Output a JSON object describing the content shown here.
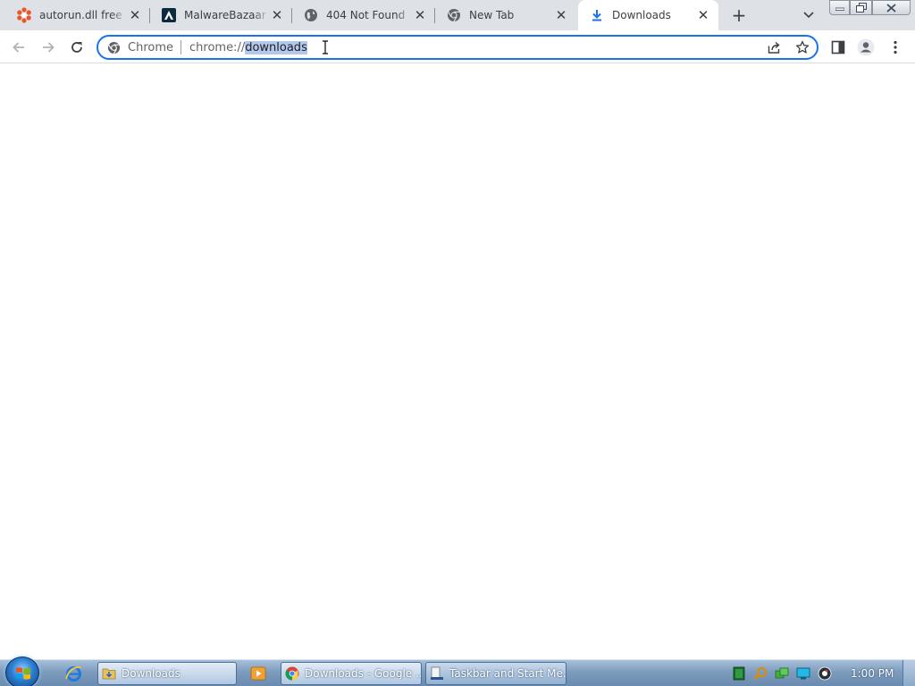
{
  "browser": {
    "tabs": [
      {
        "title": "autorun.dll free download",
        "icon": "autorun-site-icon",
        "active": false
      },
      {
        "title": "MalwareBazaar | Database",
        "icon": "malwarebazaar-icon",
        "active": false
      },
      {
        "title": "404 Not Found",
        "icon": "globe-icon",
        "active": false
      },
      {
        "title": "New Tab",
        "icon": "chrome-icon",
        "active": false
      },
      {
        "title": "Downloads",
        "icon": "download-icon",
        "active": true
      }
    ],
    "new_tab_symbol": "+",
    "close_symbol": "✕"
  },
  "omnibox": {
    "chip": "Chrome",
    "url_prefix": "chrome://",
    "url_selected": "downloads"
  },
  "taskbar": {
    "items": [
      {
        "label": "Downloads",
        "icon": "folder-icon"
      },
      {
        "label": "Downloads - Google ...",
        "icon": "chrome-icon"
      },
      {
        "label": "Taskbar and Start Me...",
        "icon": "taskbar-properties-icon"
      }
    ],
    "clock": "1:00 PM"
  },
  "colors": {
    "accent": "#1a73e8",
    "tabstrip": "#dee1e6",
    "selection": "#b4c8ec",
    "autorun_icon": "#e8572a",
    "malwarebazaar_icon": "#0d2b3e"
  }
}
